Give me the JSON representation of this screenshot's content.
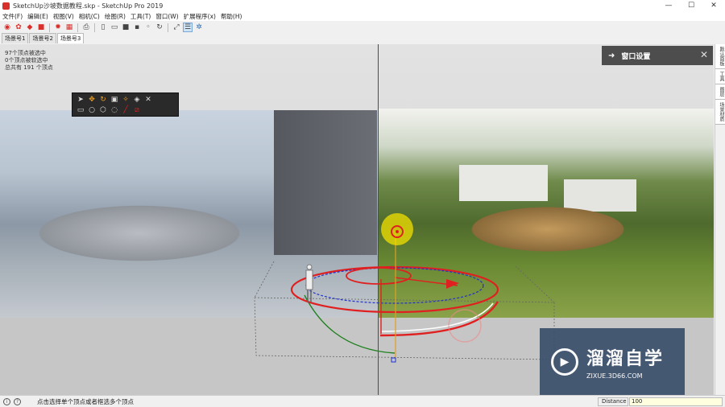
{
  "window": {
    "title": "SketchUp沙坡数据教程.skp - SketchUp Pro 2019",
    "minimize_glyph": "—",
    "maximize_glyph": "☐",
    "close_glyph": "✕"
  },
  "menu": [
    "文件(F)",
    "编辑(E)",
    "视图(V)",
    "相机(C)",
    "绘图(R)",
    "工具(T)",
    "窗口(W)",
    "扩展程序(x)",
    "帮助(H)"
  ],
  "scenes": [
    "场景号1",
    "场景号2",
    "场景号3"
  ],
  "viewport_info": {
    "line1": "97个顶点被选中",
    "line2": "0个顶点被软选中",
    "line3": "总共有 191 个顶点"
  },
  "panel": {
    "arrow": "➜",
    "title": "窗口设置",
    "close": "✕"
  },
  "right_tray": [
    "默认面板",
    "工具",
    "图层",
    "场景材质"
  ],
  "watermark": {
    "title": "溜溜自学",
    "subtitle": "ZIXUE.3D66.COM"
  },
  "status": {
    "hint": "点击选择单个顶点或者框选多个顶点",
    "measure_label": "Distance",
    "measure_value": "100"
  },
  "colors": {
    "viewport_axis": "#3a4a8a",
    "spline_red": "#e02020",
    "spline_blue": "#2030d0",
    "axis_green": "#208020",
    "highlight_yellow": "#f2e000"
  }
}
